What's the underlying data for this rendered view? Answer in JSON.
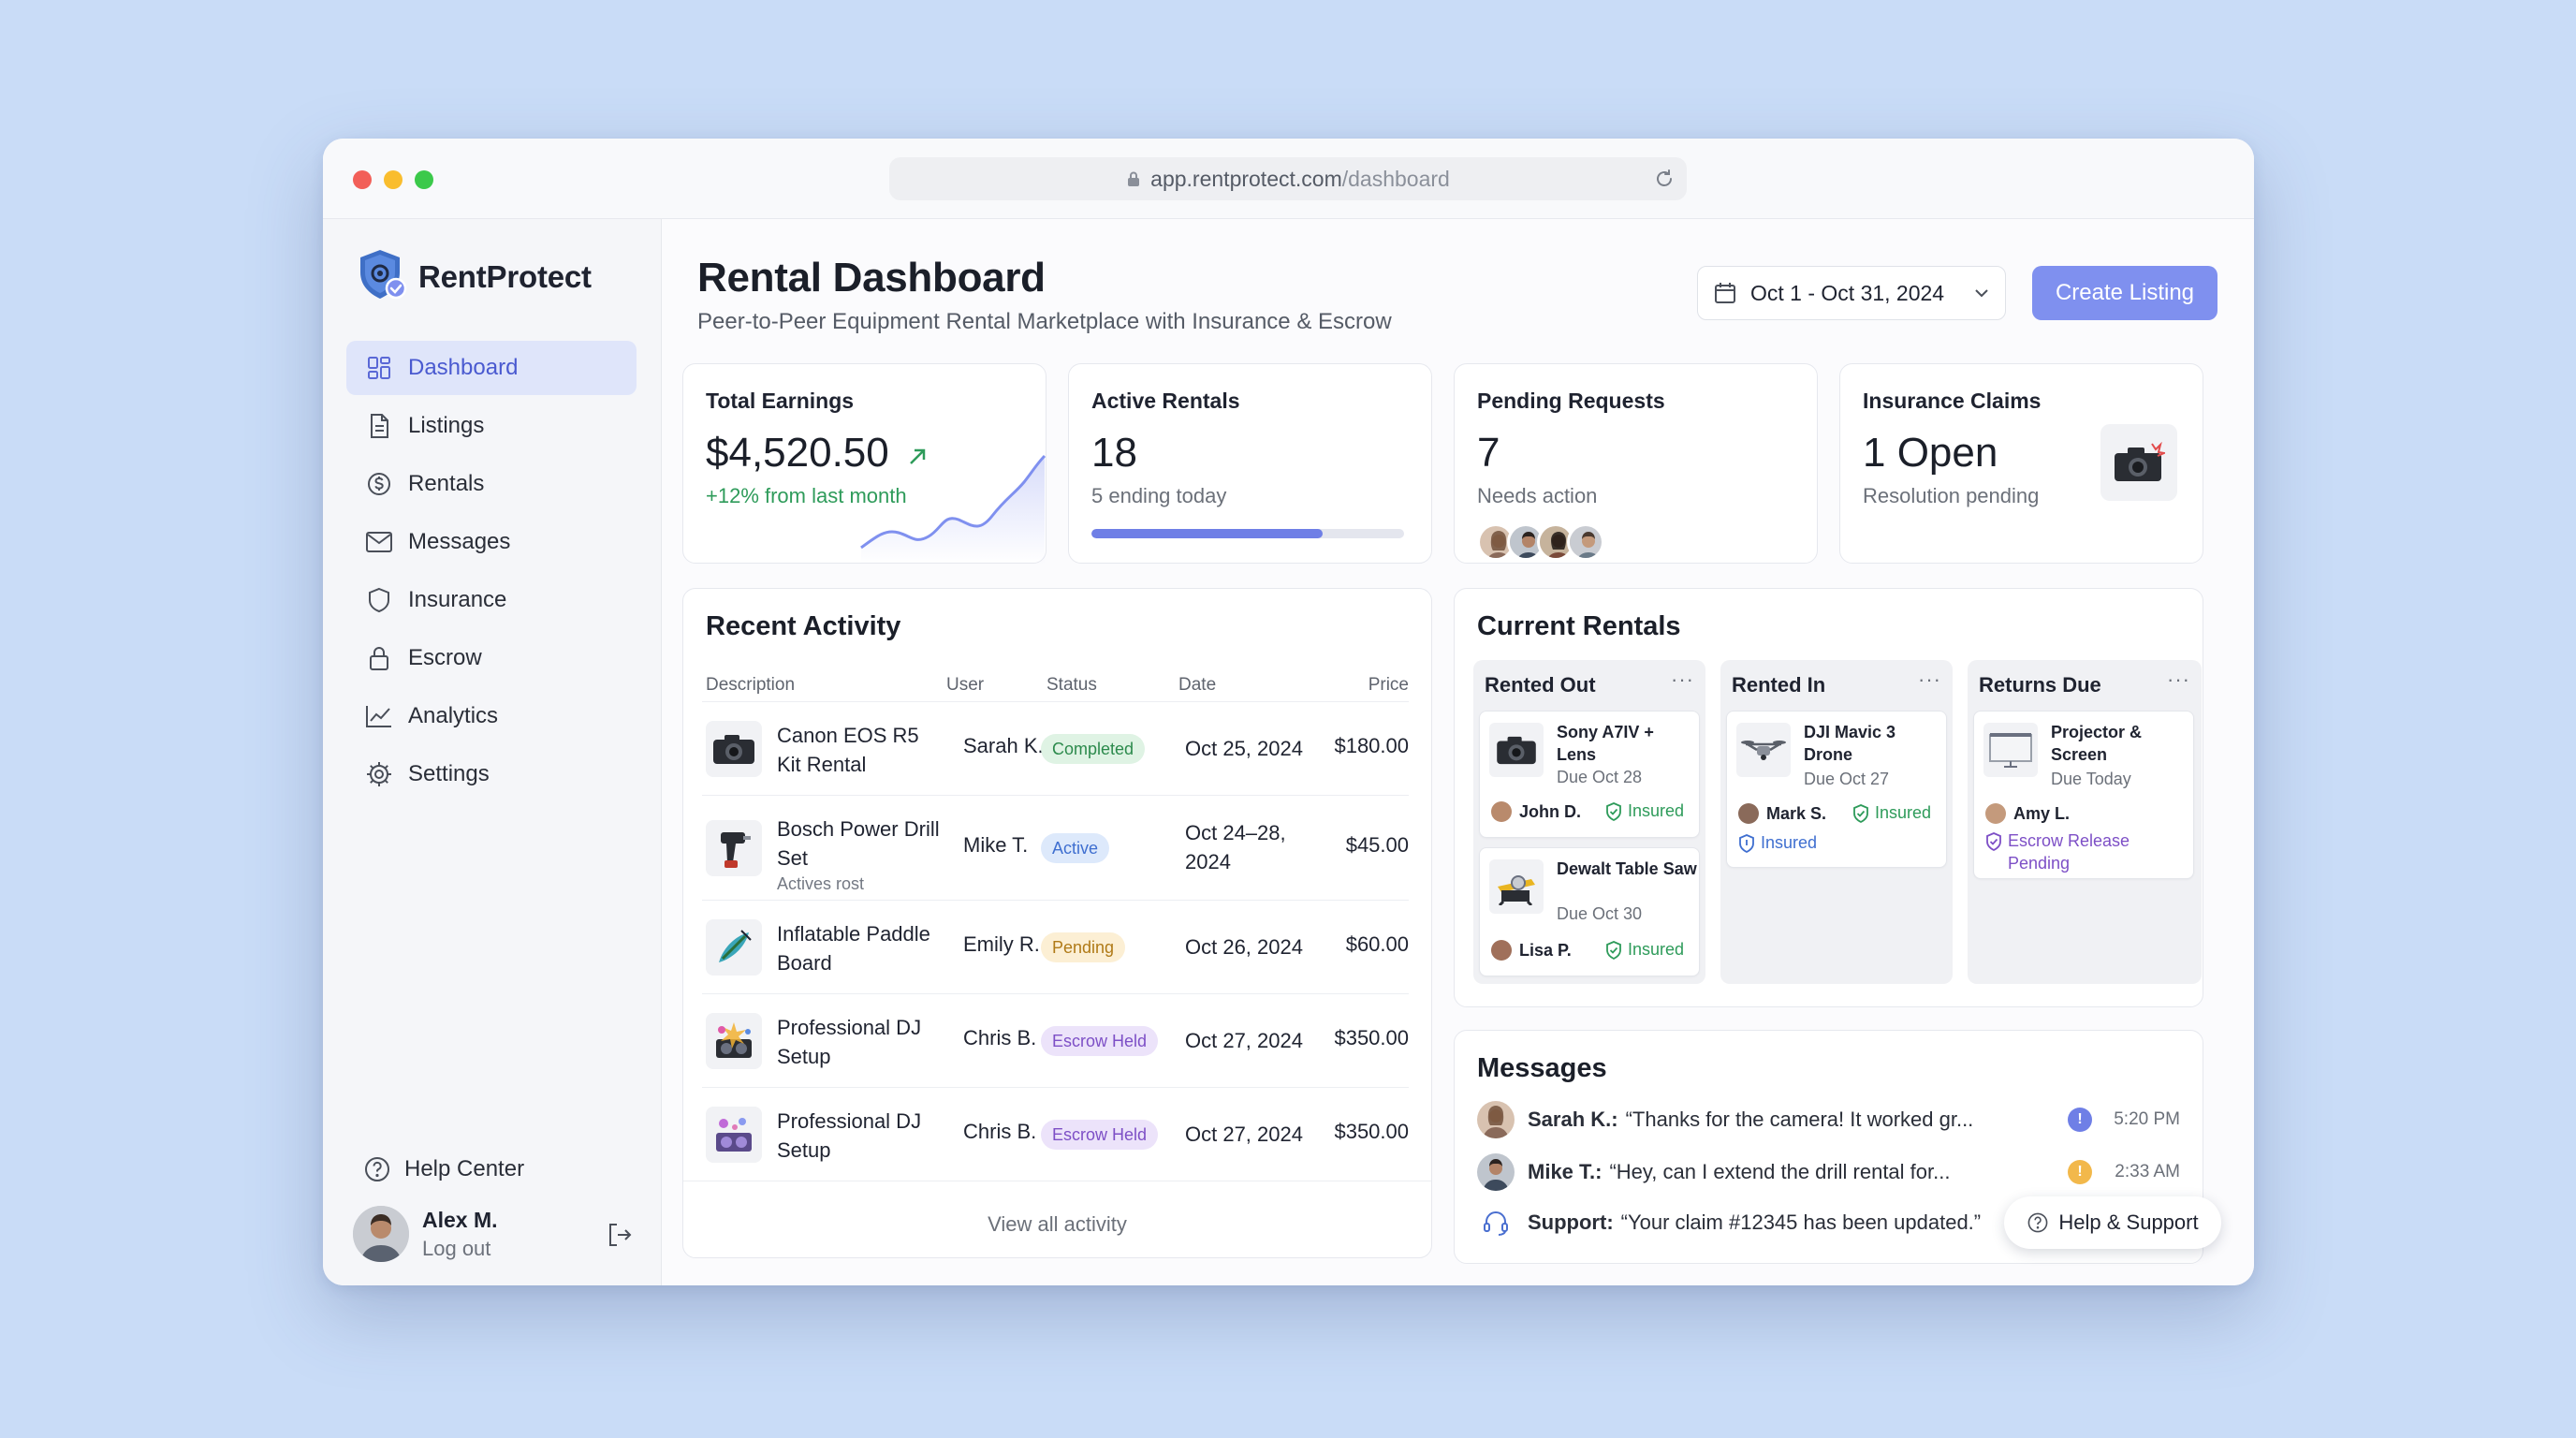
{
  "browser": {
    "url_host": "app.rentprotect.com",
    "url_path": "/dashboard"
  },
  "sidebar": {
    "brand": "RentProtect",
    "items": [
      {
        "label": "Dashboard",
        "icon": "dashboard-icon",
        "active": true
      },
      {
        "label": "Listings",
        "icon": "document-icon"
      },
      {
        "label": "Rentals",
        "icon": "dollar-circle-icon"
      },
      {
        "label": "Messages",
        "icon": "envelope-icon"
      },
      {
        "label": "Insurance",
        "icon": "shield-icon"
      },
      {
        "label": "Escrow",
        "icon": "lock-icon"
      },
      {
        "label": "Analytics",
        "icon": "chart-line-icon"
      },
      {
        "label": "Settings",
        "icon": "gear-icon"
      }
    ],
    "help_center": "Help Center",
    "user": {
      "name": "Alex M.",
      "action": "Log out"
    }
  },
  "header": {
    "title": "Rental Dashboard",
    "subtitle": "Peer-to-Peer Equipment Rental Marketplace with Insurance & Escrow",
    "date_range": "Oct 1 - Oct 31, 2024",
    "create_label": "Create Listing"
  },
  "kpis": {
    "earnings": {
      "title": "Total Earnings",
      "value": "$4,520.50",
      "sub": "+12% from last month"
    },
    "active": {
      "title": "Active Rentals",
      "value": "18",
      "sub": "5 ending today",
      "progress": 0.74
    },
    "pending": {
      "title": "Pending Requests",
      "value": "7",
      "sub": "Needs action"
    },
    "claims": {
      "title": "Insurance Claims",
      "value": "1 Open",
      "sub": "Resolution pending"
    }
  },
  "activity": {
    "title": "Recent Activity",
    "columns": [
      "Description",
      "User",
      "Status",
      "Date",
      "Price"
    ],
    "rows": [
      {
        "desc": "Canon EOS R5 Kit Rental",
        "note": "",
        "user": "Sarah K.",
        "status": "Completed",
        "status_kind": "completed",
        "date": "Oct 25, 2024",
        "price": "$180.00",
        "icon": "camera-icon"
      },
      {
        "desc": "Bosch Power Drill Set",
        "note": "Actives rost",
        "user": "Mike T.",
        "status": "Active",
        "status_kind": "active",
        "date": "Oct 24–28, 2024",
        "price": "$45.00",
        "icon": "drill-icon"
      },
      {
        "desc": "Inflatable Paddle Board",
        "note": "",
        "user": "Emily R.",
        "status": "Pending",
        "status_kind": "pending",
        "date": "Oct 26, 2024",
        "price": "$60.00",
        "icon": "paddle-board-icon"
      },
      {
        "desc": "Professional DJ Setup",
        "note": "",
        "user": "Chris B.",
        "status": "Escrow Held",
        "status_kind": "escrow",
        "date": "Oct 27, 2024",
        "price": "$350.00",
        "icon": "dj-setup-icon"
      },
      {
        "desc": "Professional DJ Setup",
        "note": "",
        "user": "Chris B.",
        "status": "Escrow Held",
        "status_kind": "escrow",
        "date": "Oct 27, 2024",
        "price": "$350.00",
        "icon": "dj-setup-icon"
      }
    ],
    "view_all": "View all activity"
  },
  "current_rentals": {
    "title": "Current Rentals",
    "columns": [
      {
        "title": "Rented Out",
        "cards": [
          {
            "name": "Sony A7IV + Lens",
            "due": "Due Oct 28",
            "user": "John D.",
            "badge": "Insured"
          },
          {
            "name": "Dewalt Table Saw",
            "due": "Due Oct 30",
            "user": "Lisa P.",
            "badge": "Insured"
          }
        ]
      },
      {
        "title": "Rented In",
        "cards": [
          {
            "name": "DJI Mavic 3 Drone",
            "due": "Due Oct 27",
            "user": "Mark S.",
            "badge": "Insured",
            "badge2": "Insured"
          }
        ]
      },
      {
        "title": "Returns Due",
        "cards": [
          {
            "name": "Projector & Screen",
            "due": "Due Today",
            "user": "Amy L.",
            "badge": "Escrow Release Pending"
          }
        ]
      }
    ]
  },
  "messages": {
    "title": "Messages",
    "items": [
      {
        "sender": "Sarah K.:",
        "text": "“Thanks for the camera! It worked gr...",
        "time": "5:20 PM",
        "badge": "!"
      },
      {
        "sender": "Mike T.:",
        "text": "“Hey, can I extend the drill rental for...",
        "time": "2:33 AM",
        "badge": "!"
      },
      {
        "sender": "Support:",
        "text": "“Your claim #12345 has been updated.”",
        "time": "",
        "badge": ""
      }
    ],
    "help_support": "Help & Support"
  },
  "colors": {
    "accent": "#7f90ef",
    "active_nav": "#dfe5fa",
    "success": "#2e9b5a"
  }
}
